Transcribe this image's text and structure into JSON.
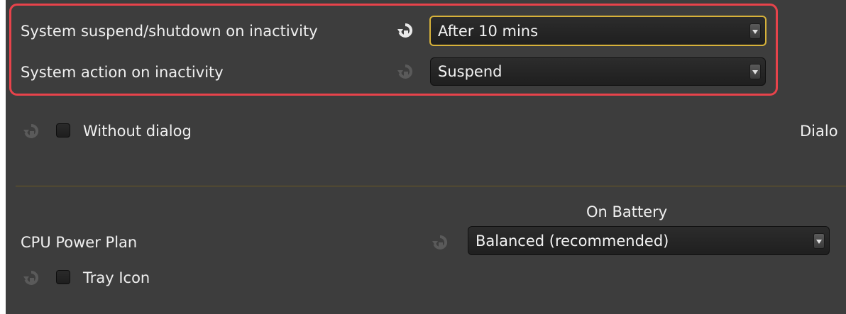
{
  "inactivity": {
    "suspend_label": "System suspend/shutdown on inactivity",
    "suspend_value": "After 10 mins",
    "action_label": "System action on inactivity",
    "action_value": "Suspend"
  },
  "without_dialog_label": "Without dialog",
  "dialog_label_cut": "Dialo",
  "power": {
    "column_header": "On Battery",
    "cpu_plan_label": "CPU Power Plan",
    "cpu_plan_value": "Balanced (recommended)",
    "tray_icon_label": "Tray Icon"
  },
  "colors": {
    "background": "#3d3d3d",
    "highlight": "#e8434b",
    "focus": "#d7b23a",
    "divider": "#6b5a22"
  }
}
